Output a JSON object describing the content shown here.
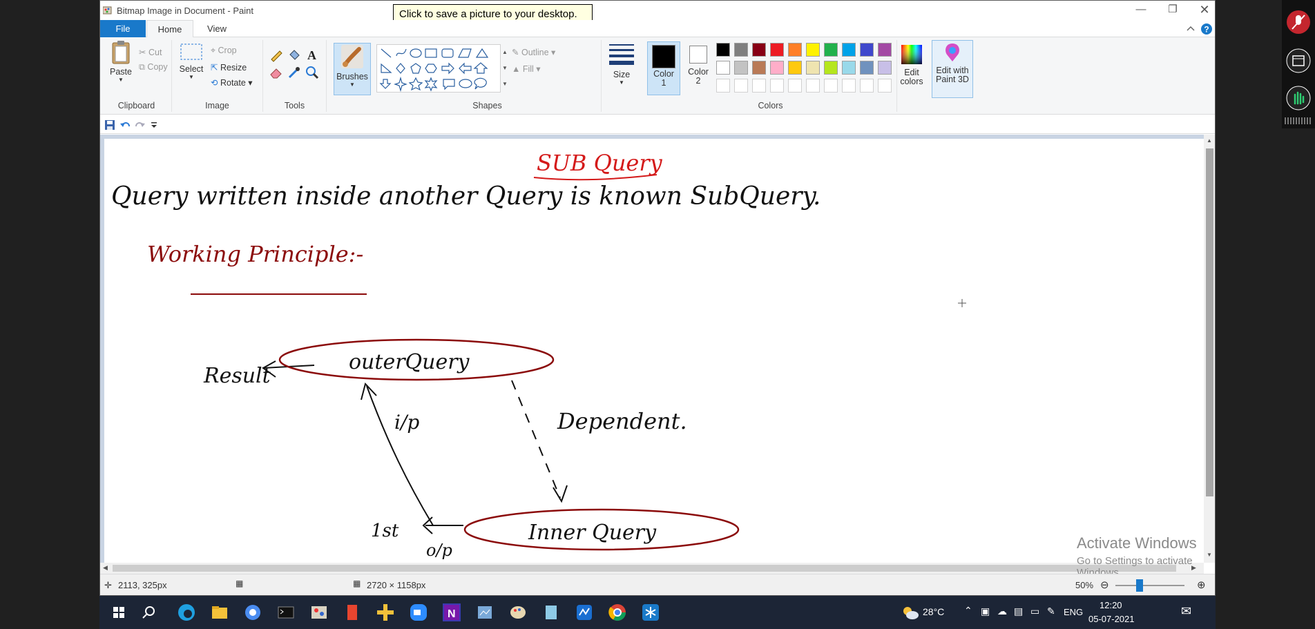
{
  "window": {
    "title": "Bitmap Image in Document - Paint",
    "tooltip": "Click to save a picture to your desktop."
  },
  "tabs": {
    "file": "File",
    "home": "Home",
    "view": "View"
  },
  "ribbon": {
    "clipboard": {
      "label": "Clipboard",
      "paste": "Paste",
      "cut": "Cut",
      "copy": "Copy"
    },
    "image": {
      "label": "Image",
      "select": "Select",
      "crop": "Crop",
      "resize": "Resize",
      "rotate": "Rotate"
    },
    "tools": {
      "label": "Tools"
    },
    "brushes": {
      "label": "Brushes"
    },
    "shapes": {
      "label": "Shapes",
      "outline": "Outline",
      "fill": "Fill"
    },
    "size": {
      "label": "Size"
    },
    "colors": {
      "label": "Colors",
      "color1": "Color 1",
      "color2": "Color 2",
      "edit": "Edit colors",
      "paint3d": "Edit with Paint 3D",
      "palette_row1": [
        "#000000",
        "#7f7f7f",
        "#880015",
        "#ed1c24",
        "#ff7f27",
        "#fff200",
        "#22b14c",
        "#00a2e8",
        "#3f48cc",
        "#a349a4"
      ],
      "palette_row2": [
        "#ffffff",
        "#c3c3c3",
        "#b97a57",
        "#ffaec9",
        "#ffc90e",
        "#efe4b0",
        "#b5e61d",
        "#99d9ea",
        "#7092be",
        "#c8bfe7"
      ]
    }
  },
  "drawing": {
    "title": "SUB Query",
    "line1": "Query written inside another Query is known SubQuery.",
    "heading": "Working Principle:-",
    "result": "Result",
    "outer": "outerQuery",
    "inner": "Inner Query",
    "dependent": "Dependent.",
    "ip": "i/p",
    "first": "1st",
    "op": "o/p"
  },
  "status": {
    "cursor": "2113, 325px",
    "size": "2720 × 1158px",
    "zoom": "50%"
  },
  "watermark": {
    "line1": "Activate Windows",
    "line2": "Go to Settings to activate Windows."
  },
  "taskbar": {
    "weather": "28°C",
    "lang": "ENG",
    "time": "12:20",
    "date": "05-07-2021"
  }
}
